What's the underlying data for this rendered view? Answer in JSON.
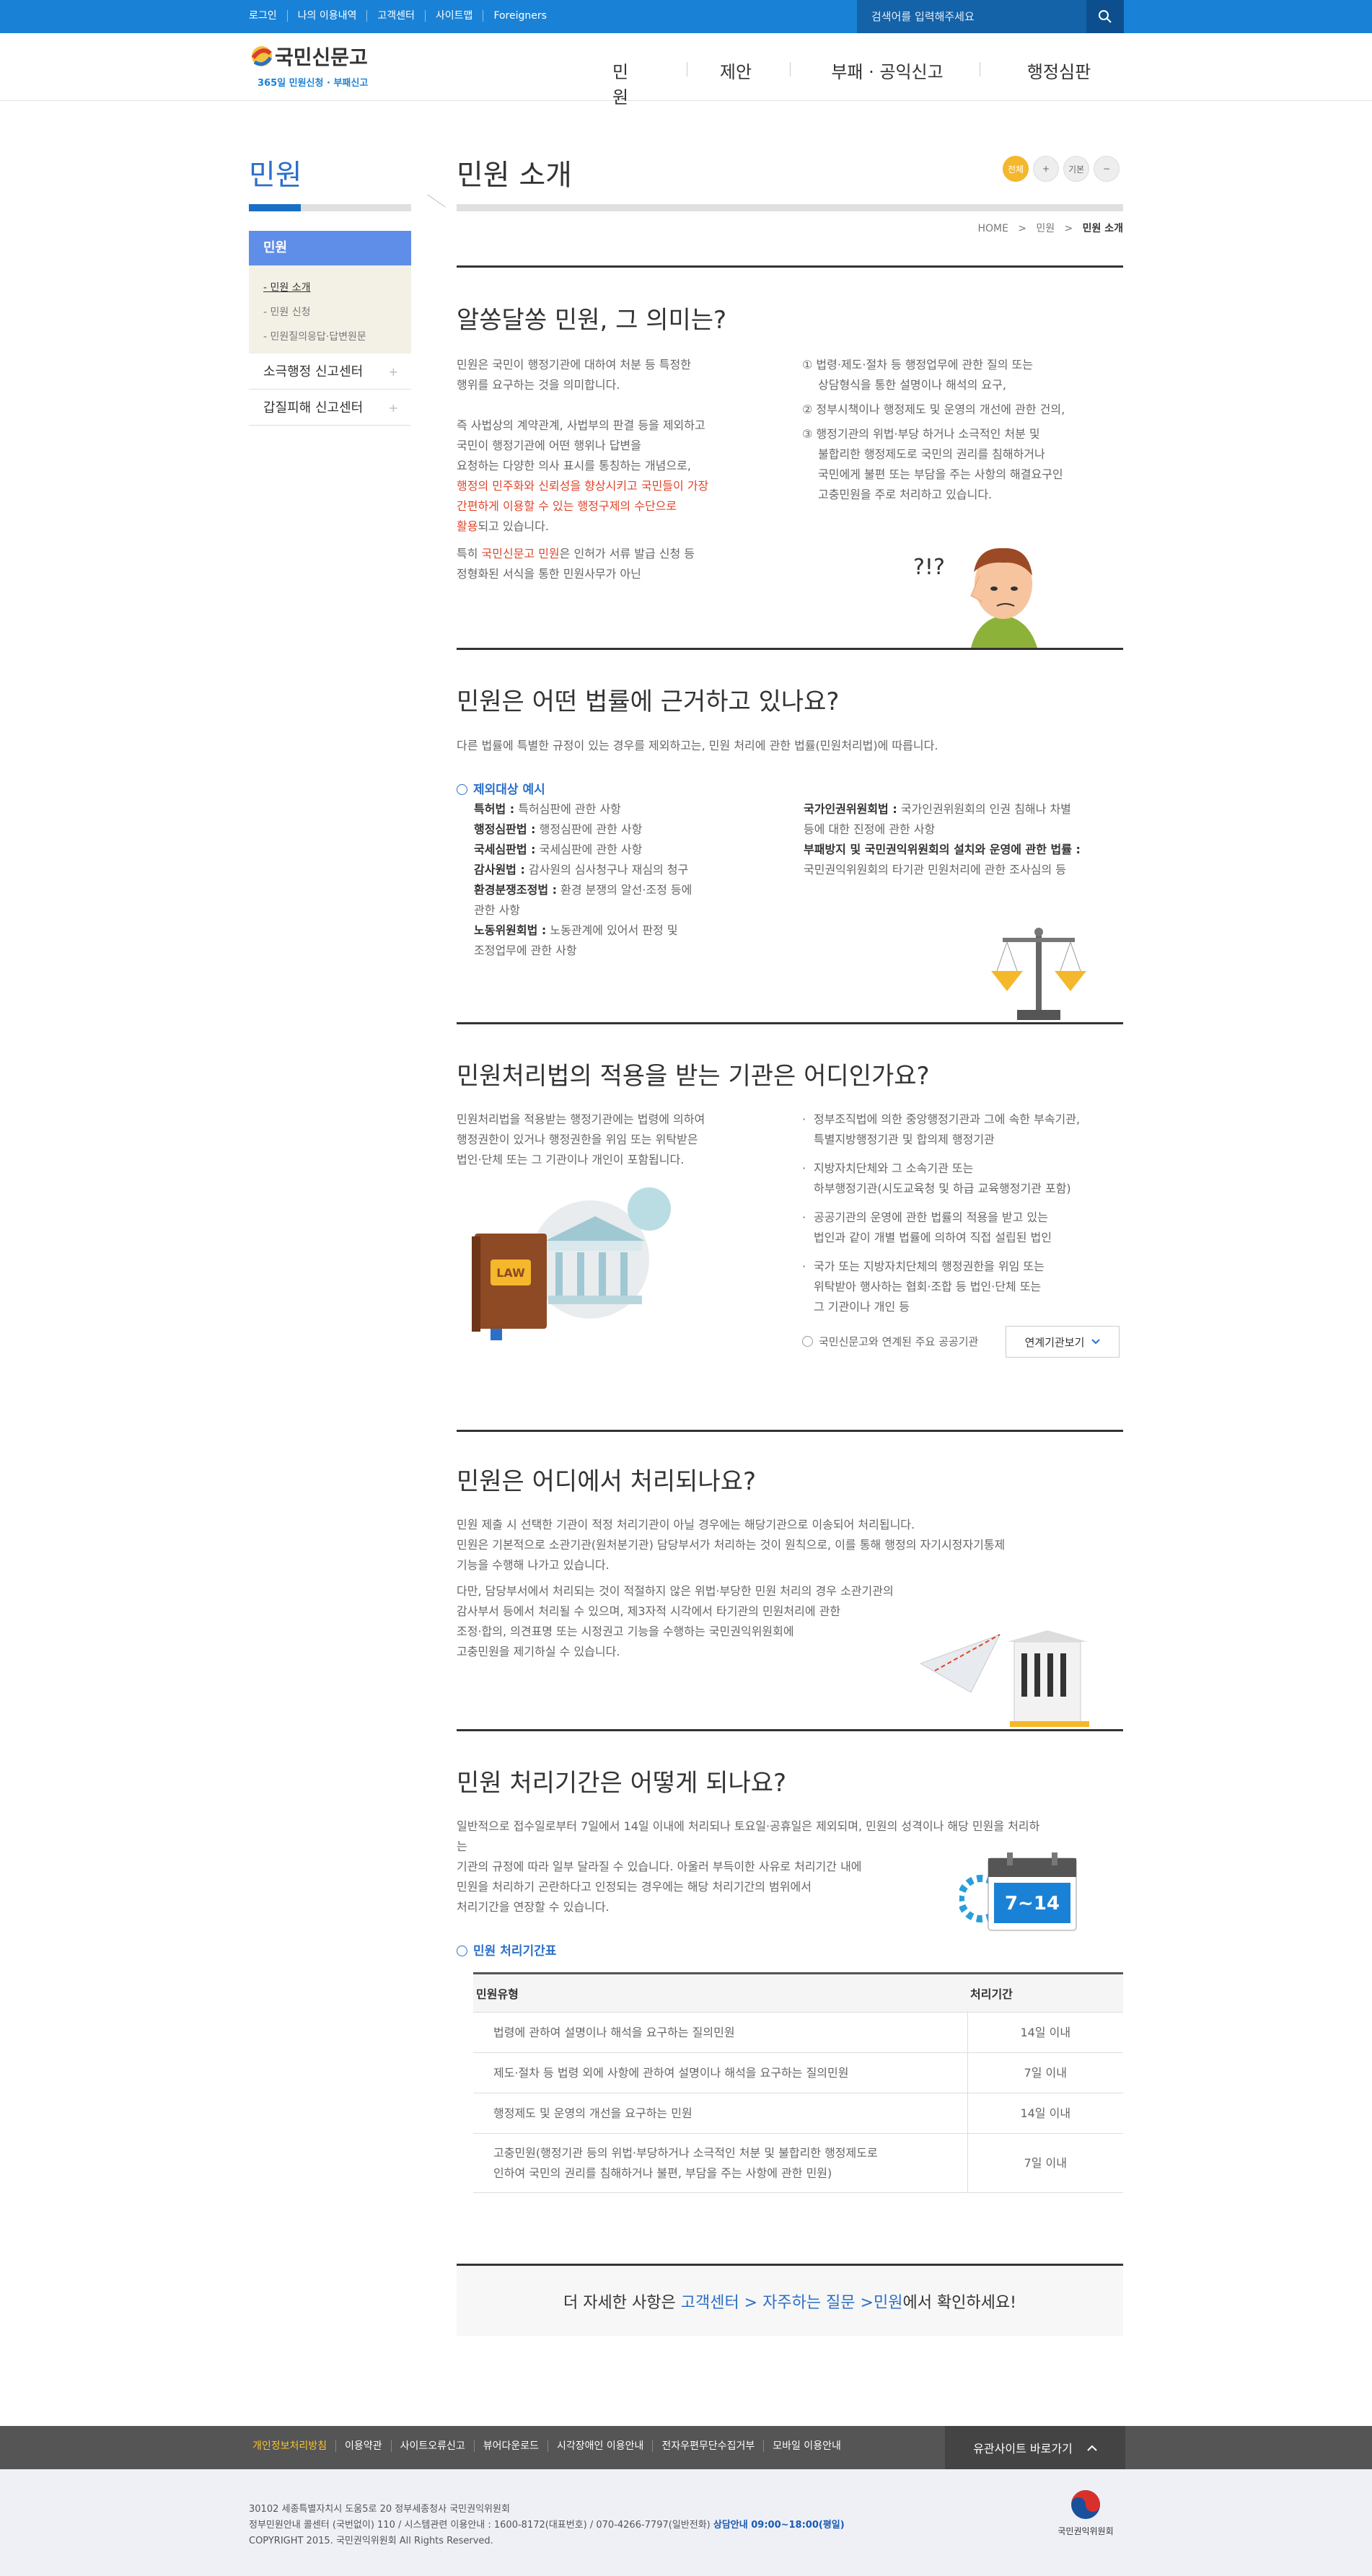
{
  "topbar": {
    "links": [
      "로그인",
      "나의 이용내역",
      "고객센터",
      "사이트맵",
      "Foreigners"
    ],
    "search_placeholder": "검색어를 입력해주세요"
  },
  "header": {
    "logo_text": "국민신문고",
    "logo_sub": "365일 민원신청 · 부패신고",
    "nav": [
      "민원",
      "제안",
      "부패 · 공익신고",
      "행정심판"
    ]
  },
  "sidebar": {
    "title": "민원",
    "active": "민원",
    "sub": [
      "민원 소개",
      "민원 신청",
      "민원질의응답·답변원문"
    ],
    "items": [
      "소극행정 신고센터",
      "갑질피해 신고센터"
    ]
  },
  "page": {
    "title": "민원 소개",
    "font_buttons": [
      "전체",
      "+",
      "기본",
      "−"
    ],
    "breadcrumb": [
      "HOME",
      ">",
      "민원",
      ">",
      "민원 소개"
    ]
  },
  "s1": {
    "title": "알쏭달쏭 민원, 그 의미는?",
    "p1": [
      "민원은 국민이 행정기관에 대하여 처분 등 특정한",
      "행위를 요구하는 것을 의미합니다."
    ],
    "p2": [
      "즉 사법상의 계약관계, 사법부의 판결 등을 제외하고",
      "국민이 행정기관에 어떤 행위나 답변을",
      "요청하는 다양한 의사 표시를 통칭하는 개념으로,"
    ],
    "p2_red": [
      "행정의 민주화와 신뢰성을 향상시키고 국민들이 가장",
      "간편하게 이용할 수 있는 행정구제의 수단으로",
      "활용"
    ],
    "p2_tail": "되고 있습니다.",
    "p3_a": "특히 ",
    "p3_red": "국민신문고 민원",
    "p3_b": "은 인허가 서류 발급 신청 등",
    "p3_c": "정형화된 서식을 통한 민원사무가 아닌",
    "list": [
      [
        "① 법령·제도·절차 등 행정업무에 관한 질의 또는",
        "상담형식을 통한 설명이나 해석의 요구,"
      ],
      [
        "② 정부시책이나 행정제도 및 운영의 개선에 관한 건의,"
      ],
      [
        "③ 행정기관의 위법·부당 하거나 소극적인 처분 및",
        "불합리한 행정제도로 국민의 권리를 침해하거나",
        "국민에게 불편 또는 부담을 주는 사항의 해결요구인",
        "고충민원을 주로 처리하고 있습니다."
      ]
    ],
    "bubble": "?!?"
  },
  "s2": {
    "title": "민원은 어떤 법률에 근거하고 있나요?",
    "intro": "다른 법률에 특별한 규정이 있는 경우를 제외하고는, 민원 처리에 관한 법률(민원처리법)에 따릅니다.",
    "exclusion_title": "제외대상 예시",
    "left": [
      {
        "law": "특허법 :",
        "desc": " 특허심판에 관한 사항"
      },
      {
        "law": "행정심판법 :",
        "desc": " 행정심판에 관한 사항"
      },
      {
        "law": "국세심판법 :",
        "desc": " 국세심판에 관한 사항"
      },
      {
        "law": "감사원법 :",
        "desc": " 감사원의 심사청구나 재심의 청구"
      },
      {
        "law": "환경분쟁조정법 :",
        "desc": " 환경 분쟁의 알선·조정 등에",
        "desc2": "관한 사항"
      },
      {
        "law": "노동위원회법 :",
        "desc": " 노동관계에 있어서 판정 및",
        "desc2": "조정업무에 관한 사항"
      }
    ],
    "right": [
      {
        "law": "국가인권위원회법 :",
        "desc": " 국가인권위원회의 인권 침해나 차별",
        "desc2": "등에 대한 진정에 관한 사항"
      },
      {
        "law": "부패방지 및 국민권익위원회의 설치와 운영에 관한 법률 :",
        "desc": "",
        "desc2": "국민권익위원회의 타기관 민원처리에 관한 조사심의 등"
      }
    ]
  },
  "s3": {
    "title": "민원처리법의 적용을 받는 기관은 어디인가요?",
    "p": [
      "민원처리법을 적용받는 행정기관에는 법령에 의하여",
      "행정권한이 있거나 행정권한을 위임 또는 위탁받은",
      "법인·단체 또는 그 기관이나 개인이 포함됩니다."
    ],
    "list": [
      [
        "정부조직법에 의한 중앙행정기관과 그에 속한 부속기관,",
        "특별지방행정기관 및 합의제 행정기관"
      ],
      [
        "지방자치단체와 그 소속기관 또는",
        "하부행정기관(시도교육청 및 하급 교육행정기관 포함)"
      ],
      [
        "공공기관의 운영에 관한 법률의 적용을 받고 있는",
        "법인과 같이 개별 법률에 의하여 직접 설립된 법인"
      ],
      [
        "국가 또는 지방자치단체의 행정권한을 위임 또는",
        "위탁받아 행사하는 협회·조합 등 법인·단체 또는",
        "그 기관이나 개인 등"
      ]
    ],
    "related": "국민신문고와 연계된 주요 공공기관",
    "related_btn": "연계기관보기",
    "book_label": "LAW"
  },
  "s4": {
    "title": "민원은 어디에서 처리되나요?",
    "p1": [
      "민원 제출 시 선택한 기관이 적정 처리기관이 아닐 경우에는 해당기관으로 이송되어 처리됩니다.",
      "민원은 기본적으로 소관기관(원처분기관) 담당부서가 처리하는 것이 원칙으로, 이를 통해 행정의 자기시정자기통제",
      "기능을 수행해 나가고 있습니다."
    ],
    "p2": [
      "다만, 담당부서에서 처리되는 것이 적절하지 않은 위법·부당한 민원 처리의 경우 소관기관의",
      "감사부서 등에서 처리될 수 있으며, 제3자적 시각에서 타기관의 민원처리에 관한",
      "조정·합의, 의견표명 또는 시정권고 기능을 수행하는 국민권익위원회에",
      "고충민원을 제기하실 수 있습니다."
    ]
  },
  "s5": {
    "title": "민원 처리기간은 어떻게 되나요?",
    "p": [
      "일반적으로 접수일로부터 7일에서 14일 이내에 처리되나 토요일·공휴일은 제외되며, 민원의 성격이나 해당 민원을 처리하",
      "는",
      "기관의 규정에 따라 일부 달라질 수 있습니다. 아울러 부득이한 사유로 처리기간 내에",
      "민원을 처리하기 곤란하다고 인정되는 경우에는 해당 처리기간의 범위에서",
      "처리기간을 연장할 수 있습니다."
    ],
    "calendar_label": "7~14",
    "table_title": "민원 처리기간표",
    "headers": [
      "민원유형",
      "처리기간"
    ],
    "rows": [
      {
        "type": "법령에 관하여 설명이나 해석을 요구하는 질의민원",
        "type2": "",
        "period": "14일 이내"
      },
      {
        "type": "제도·절차 등 법령 외에 사항에 관하여 설명이나 해석을 요구하는 질의민원",
        "type2": "",
        "period": "7일 이내"
      },
      {
        "type": "행정제도 및 운영의 개선을 요구하는 민원",
        "type2": "",
        "period": "14일 이내"
      },
      {
        "type": "고충민원(행정기관 등의 위법·부당하거나 소극적인 처분 및 불합리한 행정제도로",
        "type2": "인하여 국민의 권리를 침해하거나 불편, 부담을 주는 사항에 관한 민원)",
        "period": "7일 이내"
      }
    ]
  },
  "more": {
    "a": "더 자세한 사항은 ",
    "b": "고객센터 > 자주하는 질문 > ",
    "c": "민원",
    "d": " 에서 확인하세요!"
  },
  "footer": {
    "links": [
      "개인정보처리방침",
      "이용약관",
      "사이트오류신고",
      "뷰어다운로드",
      "시각장애인 이용안내",
      "전자우편무단수집거부",
      "모바일 이용안내"
    ],
    "family_site": "유관사이트 바로가기",
    "address": "30102 세종특별자치시 도움5로 20 정부세종청사 국민권익위원회",
    "phone_a": "정부민원안내 콜센터 (국번없이) 110 / 시스템관련 이용안내 : 1600-8172(대표번호) / 070-4266-7797(일반전화) ",
    "phone_b": "상담안내 09:00~18:00(평일)",
    "copyright": "COPYRIGHT 2015. 국민권익위원회 All Rights Reserved.",
    "org": "국민권익위원회"
  },
  "colors": {
    "primary": "#1a82d6",
    "accent": "#2b6fc9",
    "highlight": "#e0442a",
    "yellow": "#f5b72b"
  }
}
